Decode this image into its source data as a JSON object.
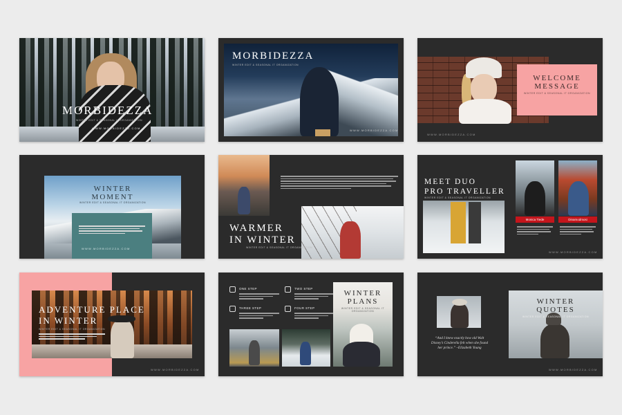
{
  "brand": "MORBIDEZZA",
  "url": "WWW.MORBIDEZZA.COM",
  "subtitle": "WINTER EDIT & SEASONAL IT ORGANIZATION",
  "slides": {
    "cover": {
      "title": "MORBIDEZZA"
    },
    "intro": {
      "title": "MORBIDEZZA"
    },
    "welcome": {
      "title_line1": "WELCOME",
      "title_line2": "MESSAGE"
    },
    "winter_moment": {
      "title_line1": "WINTER",
      "title_line2": "MOMENT"
    },
    "warmer": {
      "title_line1": "WARMER",
      "title_line2": "IN WINTER"
    },
    "meet_duo": {
      "title_line1": "MEET DUO",
      "title_line2": "PRO TRAVELLER",
      "person1": "Monica Tiede",
      "person2": "Dinamodmosi"
    },
    "adventure": {
      "title_line1": "ADVENTURE PLACE",
      "title_line2": "IN WINTER"
    },
    "plans": {
      "title_line1": "WINTER",
      "title_line2": "PLANS",
      "steps": [
        "ONE STEP",
        "TWO STEP",
        "THREE STEP",
        "FOUR STEP"
      ]
    },
    "quotes": {
      "title_line1": "WINTER",
      "title_line2": "QUOTES",
      "quote": "“And I knew exactly how old Walt Disney’s Cinderella felt when she found her prince.” –Elizabeth Young"
    }
  },
  "icons": {
    "step1": "list-icon",
    "step2": "camera-icon",
    "step3": "cup-icon",
    "step4": "shirt-icon"
  },
  "colors": {
    "slide_bg": "#2b2b2b",
    "pink": "#f7a3a3",
    "teal": "#4b7f80",
    "red_tag": "#c4151c",
    "page_bg": "#ececec"
  }
}
